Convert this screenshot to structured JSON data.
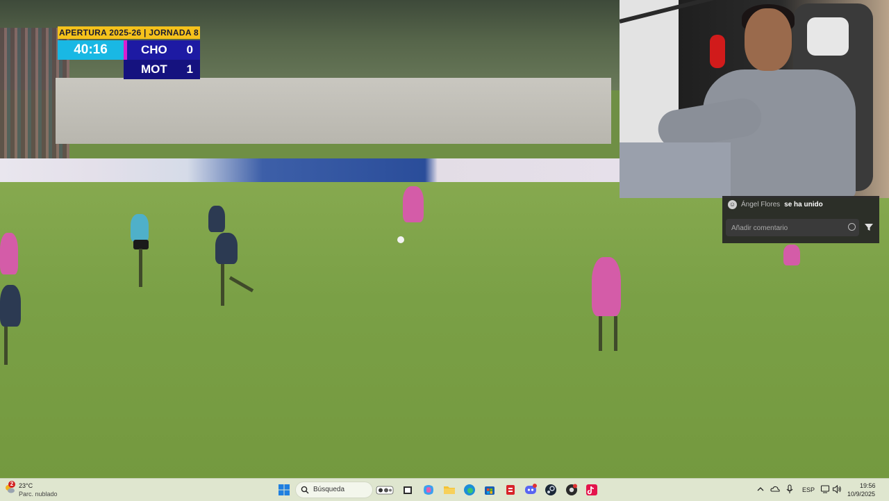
{
  "scoreboard": {
    "competition": "APERTURA 2025-26 | JORNADA 8",
    "clock": "40:16",
    "home_team": "CHO",
    "home_score": "0",
    "away_team": "MOT",
    "away_score": "1"
  },
  "chat": {
    "user": "Ángel Flores",
    "action": "se ha unido",
    "input_placeholder": "Añadir comentario"
  },
  "taskbar": {
    "weather_badge": "2",
    "weather_temp": "23°C",
    "weather_condition": "Parc. nublado",
    "search_label": "Búsqueda",
    "language": "ESP",
    "time": "19:56",
    "date": "10/9/2025",
    "icons": [
      "windows-start-icon",
      "search-icon",
      "widgets-icon",
      "task-view-icon",
      "copilot-icon",
      "file-explorer-icon",
      "edge-icon",
      "store-icon",
      "office-icon",
      "discord-icon",
      "steam-icon",
      "chrome-icon",
      "tiktok-icon"
    ]
  },
  "colors": {
    "scoreboard_header": "#f5c21b",
    "scoreboard_clock": "#19b8e4",
    "scoreboard_accent": "#d81fd0",
    "scoreboard_team_bg": "#1d1aa3",
    "taskbar_bg": "#dfe6cf"
  }
}
